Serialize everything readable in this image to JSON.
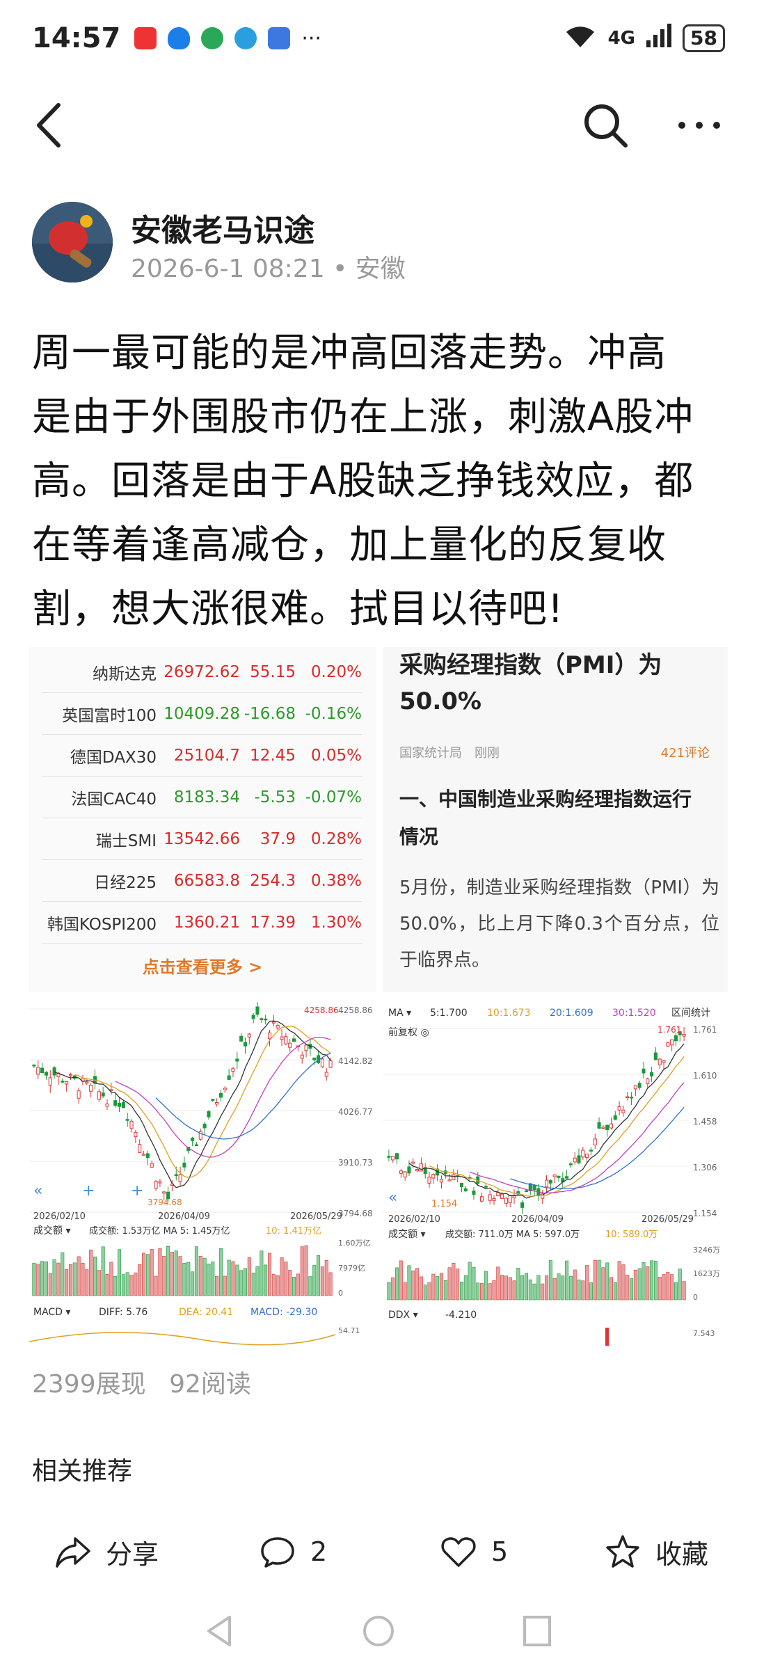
{
  "status_bar": {
    "time": "14:57",
    "signal": "6",
    "network": "4G",
    "battery": "58"
  },
  "author": {
    "name": "安徽老马识途",
    "time": "2026-6-1 08:21",
    "location": "• 安徽"
  },
  "post": {
    "lines": [
      "周一最可能的是冲高回落走势。冲高",
      "是由于外围股市仍在上涨，刺激A股冲",
      "高。回落是由于A股缺乏挣钱效应，都",
      "在等着逢高减仓，加上量化的反复收",
      "割，想大涨很难。拭目以待吧!"
    ]
  },
  "index_table": {
    "rows": [
      {
        "name": "纳斯达克",
        "value": "26972.62",
        "change": "55.15",
        "pct": "0.20%",
        "dir": "up"
      },
      {
        "name": "英国富时100",
        "value": "10409.28",
        "change": "-16.68",
        "pct": "-0.16%",
        "dir": "down"
      },
      {
        "name": "德国DAX30",
        "value": "25104.7",
        "change": "12.45",
        "pct": "0.05%",
        "dir": "up"
      },
      {
        "name": "法国CAC40",
        "value": "8183.34",
        "change": "-5.53",
        "pct": "-0.07%",
        "dir": "down"
      },
      {
        "name": "瑞士SMI",
        "value": "13542.66",
        "change": "37.9",
        "pct": "0.28%",
        "dir": "up"
      },
      {
        "name": "日经225",
        "value": "66583.8",
        "change": "254.3",
        "pct": "0.38%",
        "dir": "up"
      },
      {
        "name": "韩国KOSPI200",
        "value": "1360.21",
        "change": "17.39",
        "pct": "1.30%",
        "dir": "up"
      }
    ],
    "more": "点击查看更多 >"
  },
  "news": {
    "headline_1": "采购经理指数（PMI）为",
    "headline_2": "50.0%",
    "source": "国家统计局　刚刚",
    "comments": "421评论",
    "section_1": "一、中国制造业采购经理指数运行",
    "section_2": "情况",
    "body": "5月份，制造业采购经理指数（PMI）为50.0%，比上月下降0.3个百分点，位于临界点。"
  },
  "chart_left": {
    "high": "4258.86",
    "y1": "4258.86",
    "y2": "4142.82",
    "y3": "4026.77",
    "y4": "3910.73",
    "y5": "3794.68",
    "low": "3794.68",
    "d1": "2026/02/10",
    "d2": "2026/04/09",
    "d3": "2026/05/29",
    "vol_label": "成交额 ▾",
    "vol_stats": "成交额: 1.53万亿  MA 5: 1.45万亿",
    "vol_ma10": "10: 1.41万亿",
    "vol_y1": "1.60万亿",
    "vol_y2": "7979亿",
    "vol_y3": "0",
    "macd_label": "MACD ▾",
    "diff": "DIFF: 5.76",
    "dea": "DEA: 20.41",
    "macd": "MACD: -29.30",
    "macd_y": "54.71",
    "colors": {
      "up": "#e03434",
      "down": "#1a9a3a",
      "ma5": "#333333",
      "ma10": "#e0a020",
      "ma20": "#c040c0",
      "ma30": "#3070d0"
    }
  },
  "chart_right": {
    "ma_label": "MA ▾",
    "ma5": "5:1.700",
    "ma10": "10:1.673",
    "ma20": "20:1.609",
    "ma30": "30:1.520",
    "stat": "区间统计",
    "adj": "前复权 ◎",
    "high": "1.761",
    "y1": "1.761",
    "y2": "1.610",
    "y3": "1.458",
    "y4": "1.306",
    "y5": "1.154",
    "low": "1.154",
    "d1": "2026/02/10",
    "d2": "2026/04/09",
    "d3": "2026/05/29",
    "vol_label": "成交额 ▾",
    "vol_stats": "成交额: 711.0万  MA 5: 597.0万",
    "vol_ma10": "10: 589.0万",
    "vol_y1": "3246万",
    "vol_y2": "1623万",
    "vol_y3": "0",
    "ddx_label": "DDX ▾",
    "ddx": "-4.210",
    "ddx_y": "7.543"
  },
  "stats": {
    "views": "2399展现",
    "reads": "92阅读"
  },
  "related": "相关推荐",
  "actions": {
    "share": "分享",
    "comment": "2",
    "like": "5",
    "fav": "收藏"
  }
}
